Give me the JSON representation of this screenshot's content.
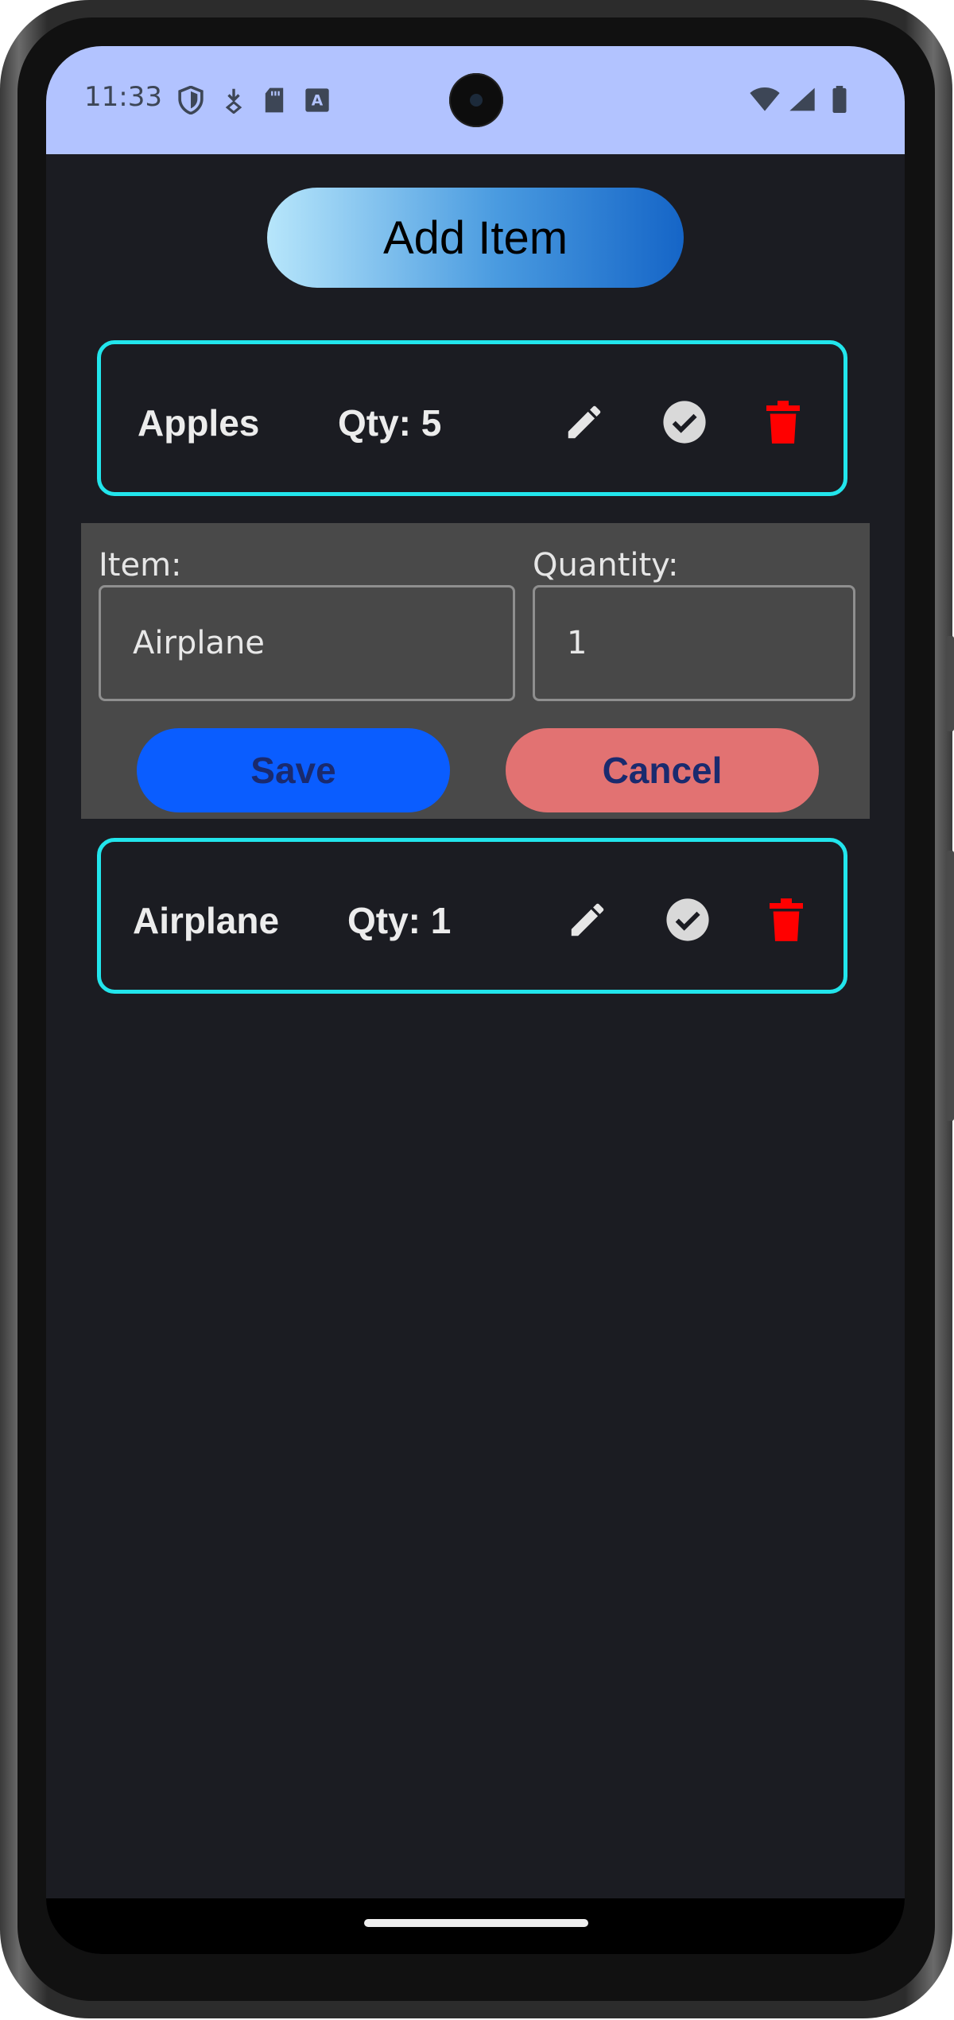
{
  "status_bar": {
    "time": "11:33",
    "left_icons": [
      "shield-icon",
      "download-icon",
      "sd-card-icon",
      "text-a-icon"
    ],
    "right_icons": [
      "wifi-icon",
      "signal-icon",
      "battery-icon"
    ]
  },
  "header": {
    "add_item_label": "Add Item"
  },
  "items": [
    {
      "name": "Apples",
      "qty_label": "Qty: 5"
    },
    {
      "name": "Airplane",
      "qty_label": "Qty: 1"
    }
  ],
  "edit_panel": {
    "item_label": "Item:",
    "item_value": "Airplane",
    "quantity_label": "Quantity:",
    "quantity_value": "1",
    "save_label": "Save",
    "cancel_label": "Cancel"
  },
  "colors": {
    "status_bar": "#b2c3ff",
    "background": "#1b1c22",
    "card_border": "#22e5ec",
    "delete_icon": "#ff0000",
    "save_button": "#0a5dff",
    "cancel_button": "#e27272"
  }
}
